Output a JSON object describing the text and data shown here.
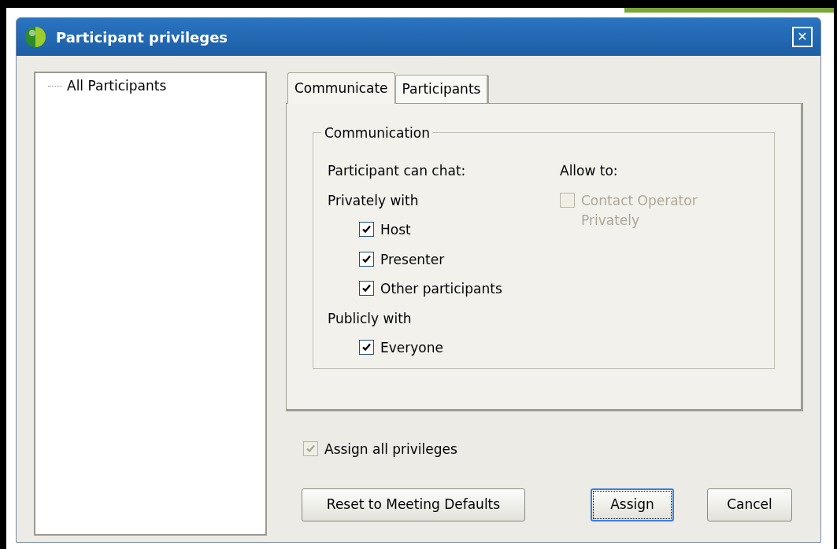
{
  "window": {
    "title": "Participant privileges",
    "close": "✕"
  },
  "tree": {
    "items": [
      {
        "label": "All Participants",
        "selected": false
      }
    ]
  },
  "tabs": [
    {
      "label": "Communicate",
      "selected": true
    },
    {
      "label": "Participants",
      "selected": false
    }
  ],
  "group": {
    "title": "Communication",
    "chat_heading": "Participant can chat:",
    "sections": [
      {
        "label": "Privately with",
        "options": [
          {
            "label": "Host",
            "checked": true,
            "disabled": false
          },
          {
            "label": "Presenter",
            "checked": true,
            "disabled": false
          },
          {
            "label": "Other participants",
            "checked": true,
            "disabled": false
          }
        ]
      },
      {
        "label": "Publicly with",
        "options": [
          {
            "label": "Everyone",
            "checked": true,
            "disabled": false
          }
        ]
      }
    ],
    "allow_heading": "Allow to:",
    "allow_options": [
      {
        "label": "Contact Operator Privately",
        "checked": false,
        "disabled": true
      }
    ]
  },
  "assign_all": {
    "label": "Assign all privileges",
    "checked": true,
    "disabled": true
  },
  "buttons": [
    {
      "label": "Reset to Meeting Defaults",
      "default": false
    },
    {
      "label": "Assign",
      "default": true
    },
    {
      "label": "Cancel",
      "default": false
    }
  ]
}
